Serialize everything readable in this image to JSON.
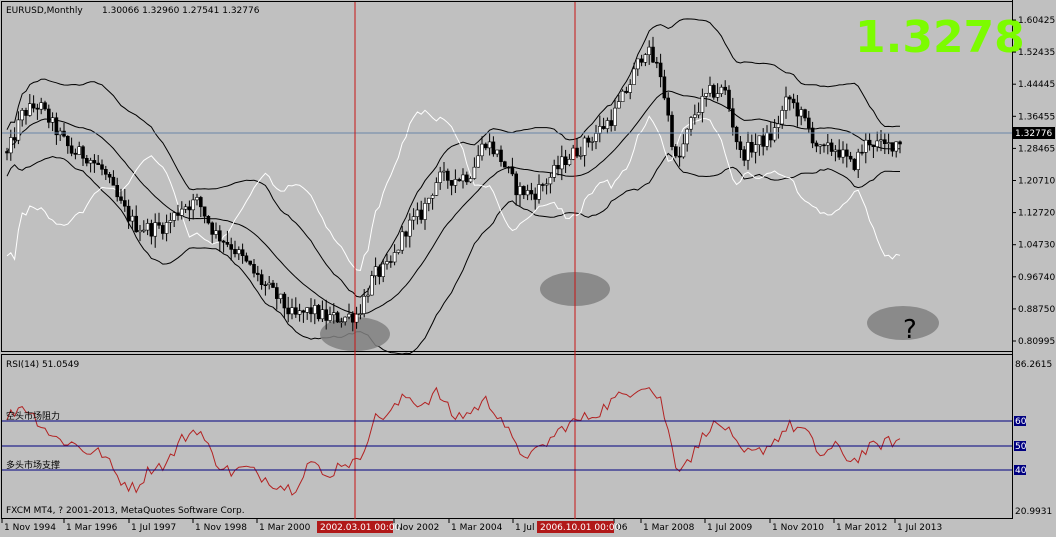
{
  "header": {
    "symbol": "EURUSD,Monthly",
    "ohlc": "1.30066 1.32960 1.27541 1.32776",
    "big_price": "1.3278",
    "question_mark": "?"
  },
  "colors": {
    "background": "#c0c0c0",
    "bull": "#ffffff",
    "bear": "#000000",
    "wick": "#000000",
    "bands": "#000000",
    "white_line": "#ffffff",
    "rsi_line": "#b22222",
    "levels": "#000080",
    "vlines": "#c81414",
    "big_price": "#7cfc00",
    "ovals": "#808080",
    "price_tag": "#000000"
  },
  "price_scale": {
    "labels": [
      "1.60425",
      "1.52435",
      "1.44445",
      "1.36455",
      "1.28465",
      "1.20710",
      "1.12720",
      "1.04730",
      "0.96740",
      "0.88750",
      "0.80995"
    ],
    "current_tag": "1.32776"
  },
  "rsi_panel": {
    "title": "RSI(14) 51.0549",
    "max_label": "86.2615",
    "min_label": "20.9931",
    "level_labels": [
      "60",
      "50",
      "40"
    ],
    "annotation_resistance": "空头市场阻力",
    "annotation_support": "多头市场支撑",
    "copyright": "FXCM MT4, ? 2001-2013, MetaQuotes Software Corp."
  },
  "time_axis": {
    "labels": [
      "1 Nov 1994",
      "1 Mar 1996",
      "1 Jul 1997",
      "1 Nov 1998",
      "1 Mar 2000",
      "Nov 2002",
      "1 Mar 2004",
      "1 Jul",
      "06",
      "1 Mar 2008",
      "1 Jul 2009",
      "1 Nov 2010",
      "1 Mar 2012",
      "1 Jul 2013"
    ],
    "selected_labels": [
      "2002.03.01 00:00",
      "2006.10.01 00:00"
    ]
  },
  "chart_data": {
    "type": "candlestick",
    "timeframe": "Monthly",
    "ylim": [
      0.80995,
      1.64
    ],
    "series": [
      {
        "name": "EURUSD",
        "values": [
          [
            "1994-11",
            1.3,
            1.29
          ],
          [
            "1995-03",
            1.34,
            1.4
          ],
          [
            "1995-07",
            1.4,
            1.42
          ],
          [
            "1995-11",
            1.39,
            1.36
          ],
          [
            "1996-03",
            1.31,
            1.3
          ],
          [
            "1996-07",
            1.3,
            1.29
          ],
          [
            "1996-11",
            1.27,
            1.25
          ],
          [
            "1997-03",
            1.18,
            1.17
          ],
          [
            "1997-07",
            1.1,
            1.11
          ],
          [
            "1997-11",
            1.12,
            1.1
          ],
          [
            "1998-03",
            1.09,
            1.11
          ],
          [
            "1998-07",
            1.13,
            1.16
          ],
          [
            "1998-11",
            1.18,
            1.17
          ],
          [
            "1999-03",
            1.1,
            1.09
          ],
          [
            "1999-07",
            1.05,
            1.06
          ],
          [
            "1999-11",
            1.02,
            1.01
          ],
          [
            "2000-03",
            0.97,
            0.96
          ],
          [
            "2000-07",
            0.93,
            0.92
          ],
          [
            "2000-11",
            0.86,
            0.87
          ],
          [
            "2001-03",
            0.91,
            0.89
          ],
          [
            "2001-07",
            0.86,
            0.87
          ],
          [
            "2001-11",
            0.88,
            0.87
          ],
          [
            "2002-03",
            0.87,
            0.88
          ],
          [
            "2002-07",
            0.95,
            0.98
          ],
          [
            "2002-11",
            0.99,
            1.0
          ],
          [
            "2003-03",
            1.08,
            1.1
          ],
          [
            "2003-07",
            1.13,
            1.14
          ],
          [
            "2003-11",
            1.18,
            1.23
          ],
          [
            "2004-03",
            1.22,
            1.23
          ],
          [
            "2004-07",
            1.22,
            1.24
          ],
          [
            "2004-11",
            1.3,
            1.33
          ],
          [
            "2005-03",
            1.3,
            1.28
          ],
          [
            "2005-07",
            1.21,
            1.2
          ],
          [
            "2005-11",
            1.18,
            1.19
          ],
          [
            "2006-03",
            1.21,
            1.23
          ],
          [
            "2006-07",
            1.27,
            1.28
          ],
          [
            "2006-11",
            1.29,
            1.31
          ],
          [
            "2007-03",
            1.33,
            1.35
          ],
          [
            "2007-07",
            1.37,
            1.39
          ],
          [
            "2007-11",
            1.45,
            1.47
          ],
          [
            "2008-03",
            1.55,
            1.57
          ],
          [
            "2008-07",
            1.56,
            1.5
          ],
          [
            "2008-11",
            1.27,
            1.26
          ],
          [
            "2009-03",
            1.32,
            1.39
          ],
          [
            "2009-07",
            1.41,
            1.45
          ],
          [
            "2009-11",
            1.49,
            1.46
          ],
          [
            "2010-03",
            1.35,
            1.29
          ],
          [
            "2010-07",
            1.3,
            1.32
          ],
          [
            "2010-11",
            1.3,
            1.34
          ],
          [
            "2011-03",
            1.41,
            1.44
          ],
          [
            "2011-07",
            1.43,
            1.38
          ],
          [
            "2011-11",
            1.34,
            1.3
          ],
          [
            "2012-03",
            1.33,
            1.31
          ],
          [
            "2012-07",
            1.23,
            1.26
          ],
          [
            "2012-11",
            1.29,
            1.33
          ],
          [
            "2013-03",
            1.28,
            1.31
          ],
          [
            "2013-07",
            1.3,
            1.33
          ]
        ]
      },
      {
        "name": "RSI(14)",
        "values": [
          [
            "1994-11",
            62
          ],
          [
            "1995-03",
            68
          ],
          [
            "1995-07",
            60
          ],
          [
            "1995-11",
            52
          ],
          [
            "1996-03",
            50
          ],
          [
            "1996-07",
            46
          ],
          [
            "1996-11",
            45
          ],
          [
            "1997-03",
            33
          ],
          [
            "1997-07",
            28
          ],
          [
            "1997-11",
            38
          ],
          [
            "1998-03",
            40
          ],
          [
            "1998-07",
            52
          ],
          [
            "1998-11",
            57
          ],
          [
            "1999-03",
            42
          ],
          [
            "1999-07",
            36
          ],
          [
            "1999-11",
            38
          ],
          [
            "2000-03",
            34
          ],
          [
            "2000-07",
            30
          ],
          [
            "2000-11",
            28
          ],
          [
            "2001-03",
            42
          ],
          [
            "2001-07",
            33
          ],
          [
            "2001-11",
            41
          ],
          [
            "2002-03",
            40
          ],
          [
            "2002-07",
            61
          ],
          [
            "2002-11",
            64
          ],
          [
            "2003-03",
            72
          ],
          [
            "2003-07",
            68
          ],
          [
            "2003-11",
            74
          ],
          [
            "2004-03",
            62
          ],
          [
            "2004-07",
            64
          ],
          [
            "2004-11",
            70
          ],
          [
            "2005-03",
            62
          ],
          [
            "2005-07",
            46
          ],
          [
            "2005-11",
            44
          ],
          [
            "2006-03",
            51
          ],
          [
            "2006-07",
            58
          ],
          [
            "2006-11",
            61
          ],
          [
            "2007-03",
            64
          ],
          [
            "2007-07",
            70
          ],
          [
            "2007-11",
            74
          ],
          [
            "2008-03",
            78
          ],
          [
            "2008-07",
            70
          ],
          [
            "2008-11",
            38
          ],
          [
            "2009-03",
            44
          ],
          [
            "2009-07",
            58
          ],
          [
            "2009-11",
            58
          ],
          [
            "2010-03",
            45
          ],
          [
            "2010-07",
            45
          ],
          [
            "2010-11",
            50
          ],
          [
            "2011-03",
            58
          ],
          [
            "2011-07",
            56
          ],
          [
            "2011-11",
            44
          ],
          [
            "2012-03",
            48
          ],
          [
            "2012-07",
            41
          ],
          [
            "2012-11",
            47
          ],
          [
            "2013-03",
            50
          ],
          [
            "2013-07",
            51
          ]
        ]
      }
    ],
    "rsi_levels": [
      60,
      50,
      40
    ],
    "rsi_range": [
      20.9931,
      86.2615
    ],
    "legend": "none"
  }
}
